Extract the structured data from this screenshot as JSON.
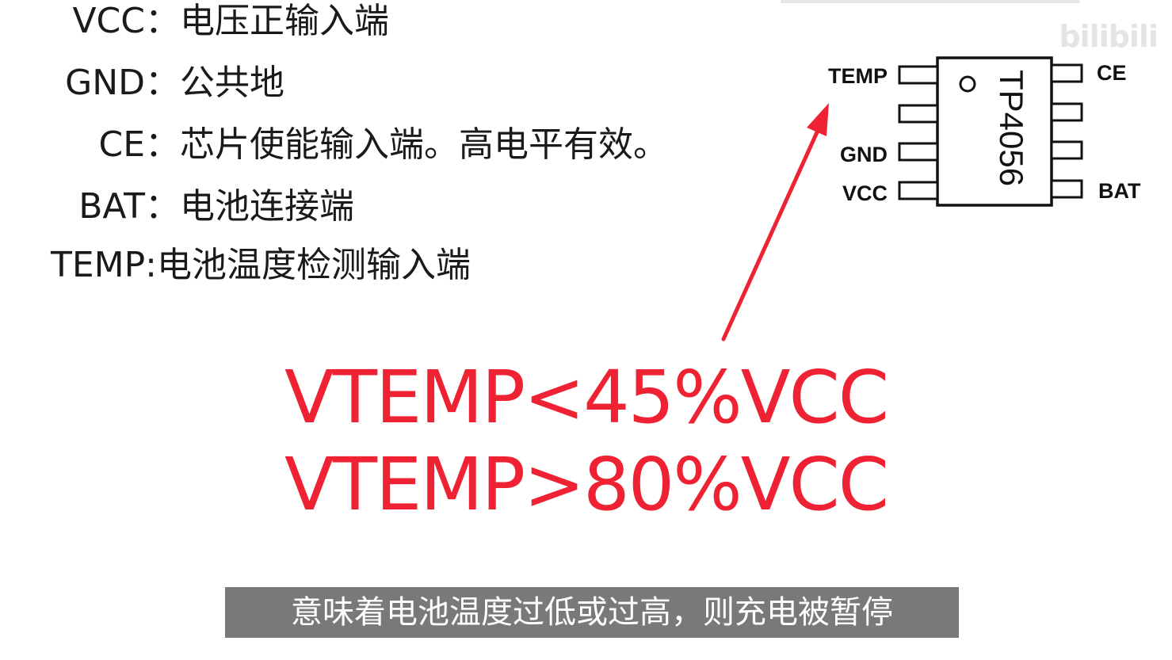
{
  "pins": [
    {
      "name": "VCC：",
      "desc": "电压正输入端"
    },
    {
      "name": "GND：",
      "desc": "公共地"
    },
    {
      "name": "CE：",
      "desc": "芯片使能输入端。高电平有效。"
    },
    {
      "name": "BAT：",
      "desc": "电池连接端"
    },
    {
      "name": "TEMP:",
      "desc": "电池温度检测输入端"
    }
  ],
  "chip": {
    "label": "TP4056",
    "left_pins": [
      "TEMP",
      "GND",
      "VCC"
    ],
    "right_pins": [
      "CE",
      "BAT"
    ]
  },
  "formulas": [
    "VTEMP<45%VCC",
    "VTEMP>80%VCC"
  ],
  "subtitle": "意味着电池温度过低或过高，则充电被暂停",
  "watermark": "bilibili",
  "colors": {
    "accent": "#ee2233",
    "subtitle_bg": "#6e6e6e"
  }
}
